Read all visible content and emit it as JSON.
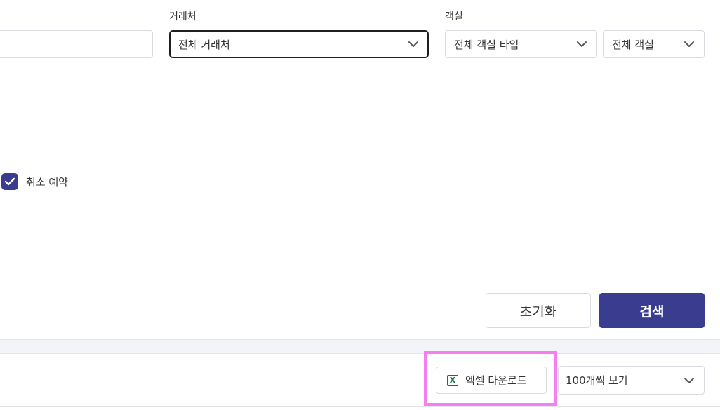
{
  "filters": {
    "partner": {
      "label": "거래처",
      "value": "전체 거래처"
    },
    "room": {
      "label": "객실",
      "type_value": "전체 객실 타입",
      "room_value": "전체 객실"
    }
  },
  "options": {
    "cancel_reservation": {
      "label": "취소 예약",
      "checked": true
    }
  },
  "actions": {
    "reset_label": "초기화",
    "search_label": "검색"
  },
  "results_toolbar": {
    "excel_label": "엑셀 다운로드",
    "excel_icon": "excel-icon",
    "page_size": "100개씩 보기"
  },
  "colors": {
    "primary": "#3a3d8f",
    "highlight": "#f57ff0",
    "excel_green": "#1d6f42"
  }
}
